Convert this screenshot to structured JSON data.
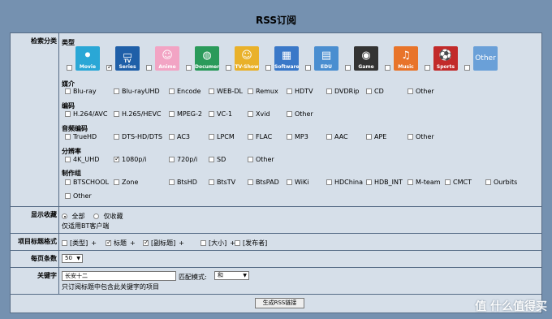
{
  "page_title": "RSS订阅",
  "section_search_label": "检索分类",
  "type": {
    "label": "类型",
    "tiles": [
      {
        "name": "Movie",
        "color": "#2aa7d6",
        "glyph": "⚫",
        "checked": false
      },
      {
        "name": "TV Series",
        "color": "#1f5fa8",
        "glyph": "▭",
        "checked": true
      },
      {
        "name": "Anime",
        "color": "#f2a4c4",
        "glyph": "☺",
        "checked": false
      },
      {
        "name": "Documentary",
        "color": "#2a9a5a",
        "glyph": "◍",
        "checked": false
      },
      {
        "name": "TV-Show",
        "color": "#e9b12a",
        "glyph": "☺",
        "checked": false
      },
      {
        "name": "Software",
        "color": "#3a78c8",
        "glyph": "▦",
        "checked": false
      },
      {
        "name": "EDU",
        "color": "#4a8ed0",
        "glyph": "▤",
        "checked": false
      },
      {
        "name": "Game",
        "color": "#333333",
        "glyph": "◉",
        "checked": false
      },
      {
        "name": "Music",
        "color": "#e8742a",
        "glyph": "♫",
        "checked": false
      },
      {
        "name": "Sports",
        "color": "#c22a2a",
        "glyph": "⚽",
        "checked": false
      },
      {
        "name": "Other",
        "color": "#6aa0d8",
        "glyph": "",
        "checked": false
      }
    ]
  },
  "media": {
    "label": "媒介",
    "options": [
      "Blu-ray",
      "Blu-rayUHD",
      "Encode",
      "WEB-DL",
      "Remux",
      "HDTV",
      "DVDRip",
      "CD",
      "Other"
    ]
  },
  "codec": {
    "label": "编码",
    "options": [
      "H.264/AVC",
      "H.265/HEVC",
      "MPEG-2",
      "VC-1",
      "Xvid",
      "Other"
    ]
  },
  "audio": {
    "label": "音频编码",
    "options": [
      "TrueHD",
      "DTS-HD/DTS",
      "AC3",
      "LPCM",
      "FLAC",
      "MP3",
      "AAC",
      "APE",
      "Other"
    ]
  },
  "resolution": {
    "label": "分辨率",
    "options": [
      {
        "label": "4K_UHD",
        "checked": false
      },
      {
        "label": "1080p/i",
        "checked": true
      },
      {
        "label": "720p/i",
        "checked": false
      },
      {
        "label": "SD",
        "checked": false
      },
      {
        "label": "Other",
        "checked": false
      }
    ]
  },
  "group": {
    "label": "制作组",
    "options": [
      "BTSCHOOL",
      "Zone",
      "BtsHD",
      "BtsTV",
      "BtsPAD",
      "WiKi",
      "HDChina",
      "HDB_INT",
      "M-team",
      "CMCT",
      "Ourbits",
      "Other"
    ]
  },
  "favorites": {
    "label": "显示收藏",
    "all": "全部",
    "fav_only": "仅收藏",
    "note": "仅适用BT客户端"
  },
  "title_format": {
    "label": "项目标题格式",
    "parts": [
      {
        "label": "[类型]",
        "checked": false
      },
      {
        "label": "标题",
        "checked": true
      },
      {
        "label": "[副标题]",
        "checked": true
      },
      {
        "label": "[大小]",
        "checked": false
      },
      {
        "label": "[发布者]",
        "checked": false
      }
    ],
    "plus": "+"
  },
  "per_page": {
    "label": "每页条数",
    "value": "50"
  },
  "keyword": {
    "label": "关键字",
    "value": "长安十二",
    "match_label": "匹配模式:",
    "match_value": "和",
    "note": "只订阅标题中包含此关键字的项目"
  },
  "generate_button": "生成RSS链接",
  "watermark": "值 什么值得买"
}
